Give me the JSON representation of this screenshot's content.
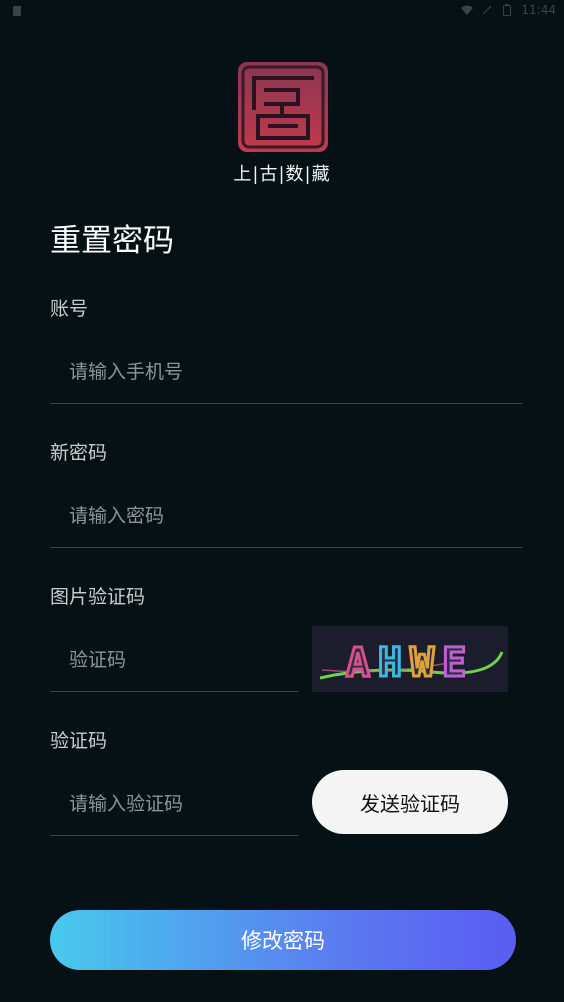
{
  "status_bar": {
    "time": "11:44",
    "icons": [
      "notification-icon",
      "wifi-icon",
      "no-sim-icon",
      "battery-icon"
    ]
  },
  "logo": {
    "text": "上|古|数|藏",
    "seal_icon": "seal-logo-icon",
    "seal_color": "#b33a4a"
  },
  "page_title": "重置密码",
  "form": {
    "account": {
      "label": "账号",
      "placeholder": "请输入手机号",
      "value": ""
    },
    "new_password": {
      "label": "新密码",
      "placeholder": "请输入密码",
      "value": ""
    },
    "image_captcha": {
      "label": "图片验证码",
      "placeholder": "验证码",
      "value": "",
      "captcha_text": "AHWE"
    },
    "sms_code": {
      "label": "验证码",
      "placeholder": "请输入验证码",
      "value": "",
      "send_button_label": "发送验证码"
    }
  },
  "submit_button_label": "修改密码",
  "colors": {
    "background": "#051114",
    "gradient_start": "#47c9ec",
    "gradient_end": "#5a5cf2"
  }
}
